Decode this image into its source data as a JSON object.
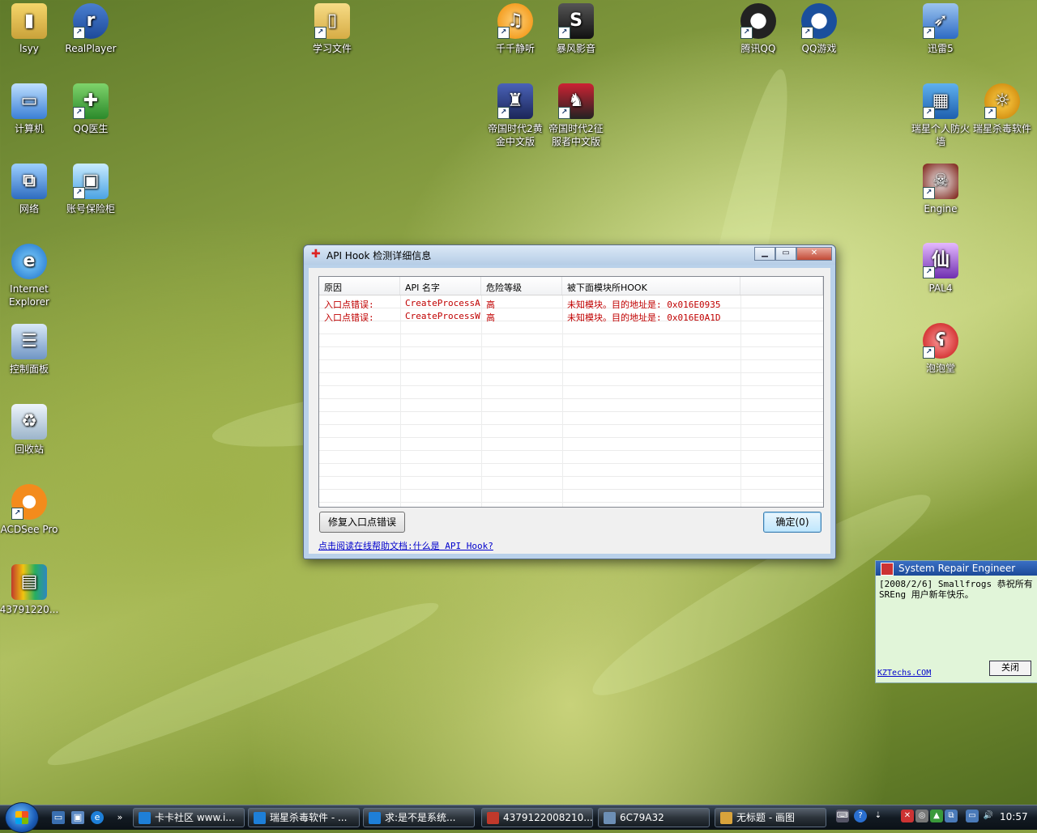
{
  "desktop": {
    "icons": [
      {
        "label": "lsyy"
      },
      {
        "label": "RealPlayer"
      },
      {
        "label": "学习文件"
      },
      {
        "label": "千千静听"
      },
      {
        "label": "暴风影音"
      },
      {
        "label": "腾讯QQ"
      },
      {
        "label": "QQ游戏"
      },
      {
        "label": "迅雷5"
      },
      {
        "label": "计算机"
      },
      {
        "label": "QQ医生"
      },
      {
        "label": "帝国时代2黄金中文版"
      },
      {
        "label": "帝国时代2征服者中文版"
      },
      {
        "label": "瑞星个人防火墙"
      },
      {
        "label": "瑞星杀毒软件"
      },
      {
        "label": "网络"
      },
      {
        "label": "账号保险柜"
      },
      {
        "label": "Engine"
      },
      {
        "label": "Internet Explorer"
      },
      {
        "label": "PAL4"
      },
      {
        "label": "控制面板"
      },
      {
        "label": "泡泡堂"
      },
      {
        "label": "回收站"
      },
      {
        "label": "ACDSee Pro"
      },
      {
        "label": "43791220..."
      }
    ]
  },
  "dialog": {
    "title": "API Hook 检测详细信息",
    "columns": [
      "原因",
      "API 名字",
      "危险等级",
      "被下面模块所HOOK",
      ""
    ],
    "rows": [
      [
        "入口点错误:",
        "CreateProcessA",
        "高",
        "未知模块。目的地址是: 0x016E0935"
      ],
      [
        "入口点错误:",
        "CreateProcessW",
        "高",
        "未知模块。目的地址是: 0x016E0A1D"
      ]
    ],
    "fix_button": "修复入口点错误",
    "ok_button": "确定(0)",
    "help_link": "点击阅读在线帮助文档:什么是 API Hook?"
  },
  "notification": {
    "title": "System Repair Engineer",
    "message": "[2008/2/6] Smallfrogs 恭祝所有 SREng 用户新年快乐。",
    "link": "KZTechs.COM",
    "close_button": "关闭"
  },
  "taskbar": {
    "tasks": [
      {
        "label": "卡卡社区 www.i...",
        "color": "#1e7fd8"
      },
      {
        "label": "瑞星杀毒软件 - ...",
        "color": "#1e7fd8"
      },
      {
        "label": "求:是不是系统...",
        "color": "#1e7fd8"
      },
      {
        "label": "4379122008210...",
        "color": "#c0392b"
      },
      {
        "label": "6C79A32",
        "color": "#6d8fb5"
      },
      {
        "label": "无标题 - 画图",
        "color": "#d9a33b"
      }
    ],
    "clock": "10:57"
  }
}
